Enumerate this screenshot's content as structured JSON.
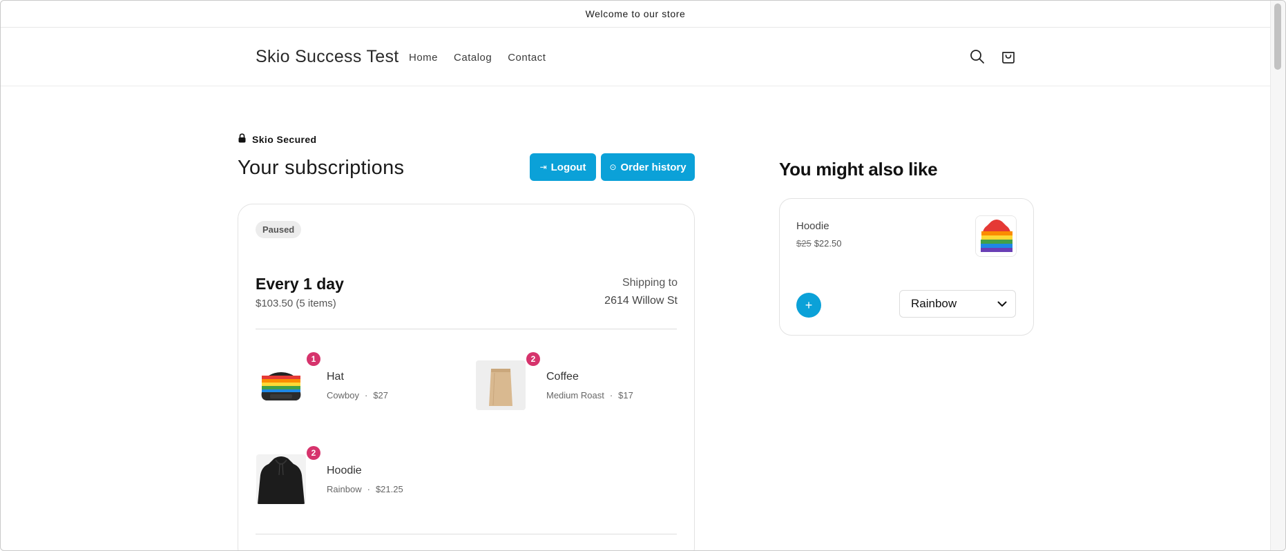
{
  "announcement": "Welcome to our store",
  "header": {
    "logo": "Skio Success Test",
    "nav": [
      "Home",
      "Catalog",
      "Contact"
    ],
    "search_icon": "search-icon",
    "cart_icon": "cart-icon"
  },
  "page": {
    "secured_label": "Skio Secured",
    "title": "Your subscriptions",
    "logout_label": "Logout",
    "order_history_label": "Order history"
  },
  "subscription": {
    "status": "Paused",
    "frequency": "Every 1 day",
    "total": "$103.50 (5 items)",
    "shipping_label": "Shipping to",
    "shipping_address": "2614 Willow St",
    "items": [
      {
        "name": "Hat",
        "variant": "Cowboy",
        "price": "$27",
        "qty": "1"
      },
      {
        "name": "Coffee",
        "variant": "Medium Roast",
        "price": "$17",
        "qty": "2"
      },
      {
        "name": "Hoodie",
        "variant": "Rainbow",
        "price": "$21.25",
        "qty": "2"
      }
    ]
  },
  "upsell": {
    "title": "You might also like",
    "product": {
      "name": "Hoodie",
      "original_price": "$25",
      "sale_price": "$22.50",
      "variant_selected": "Rainbow"
    }
  },
  "colors": {
    "accent": "#0ba1d8",
    "qty_badge": "#d6336c"
  }
}
